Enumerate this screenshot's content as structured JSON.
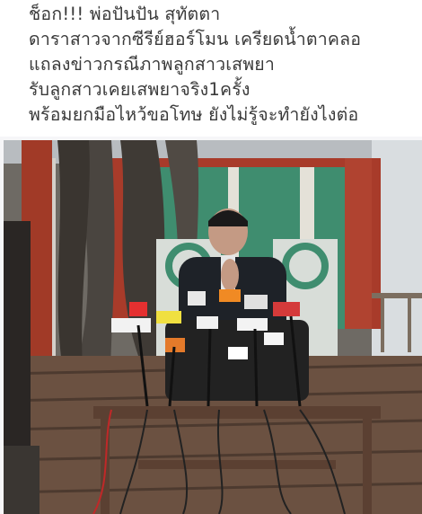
{
  "post": {
    "caption_lines": [
      "ช็อก!!! พ่อปันปัน สุทัตตา",
      "ดาราสาวจากซีรีย์ฮอร์โมน เครียดน้ำตาคลอ",
      "แถลงข่าวกรณีภาพลูกสาวเสพยา",
      "รับลูกสาวเคยเสพยาจริง1ครั้ง",
      "พร้อมยกมือไหว้ขอโทษ ยังไม่รู้จะทำยังไงต่อ"
    ],
    "photo": {
      "description_icon": "press-conference-photo"
    }
  },
  "colors": {
    "background": "#f6f6f8",
    "caption_text": "#3a3a3a",
    "wall_green": "#3f8d6f",
    "wall_red": "#a83b2a",
    "deck": "#6b5141"
  }
}
